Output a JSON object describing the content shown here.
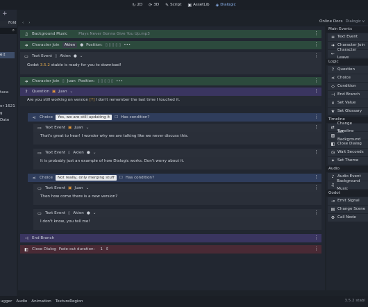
{
  "topbar": {
    "modes": [
      {
        "icon": "↻",
        "label": "2D"
      },
      {
        "icon": "⟳",
        "label": "3D"
      },
      {
        "icon": "✎",
        "label": "Script"
      },
      {
        "icon": "▣",
        "label": "AssetLib"
      },
      {
        "icon": "◈",
        "label": "Dialogic"
      }
    ]
  },
  "left": {
    "filter_label": "Fold",
    "items": [
      "e.t",
      "taca",
      "er 1621",
      "g",
      "Date"
    ]
  },
  "top_right": {
    "docs": "Online Docs",
    "dialogic": "Dialogic v"
  },
  "timeline": {
    "bg_music": {
      "label": "Background Music",
      "file": "Plays Never Gonna Give You Up.mp3"
    },
    "join1": {
      "label": "Character Join",
      "character": "Akien",
      "pos_label": "Position:"
    },
    "text1": {
      "label": "Text Event",
      "character": "Akien",
      "body_a": "Godot ",
      "body_ver": "3.5.2",
      "body_b": " stable is ready for you to download!"
    },
    "join2": {
      "label": "Character Join",
      "character": "Juan",
      "pos_label": "Position:"
    },
    "question": {
      "label": "Question",
      "character": "Juan",
      "body": "Are you still working on version ",
      "body_b": "[?]",
      "body_c": " I don't remember the last time I touched it."
    },
    "choice1": {
      "label": "Choice",
      "value": "Yes, we are still updating it",
      "cond": "Has condition?"
    },
    "text2": {
      "label": "Text Event",
      "character": "Juan",
      "body": "That's great to hear! I wonder why we are talking like we never discuss this."
    },
    "text3": {
      "label": "Text Event",
      "character": "Akien",
      "body": "It is probably just an example of how Dialogic works. Don't worry about it."
    },
    "choice2": {
      "label": "Choice",
      "value": "Not really, only merging stuff",
      "cond": "Has condition?"
    },
    "text4": {
      "label": "Text Event",
      "character": "Juan",
      "body": "Then how come there is a new version?"
    },
    "text5": {
      "label": "Text Event",
      "character": "Akien",
      "body": "I don't know, you tell me!"
    },
    "end_branch": {
      "label": "End Branch"
    },
    "close_dialog": {
      "label": "Close Dialog",
      "fade": "Fade-out duration:",
      "fade_value": "1"
    }
  },
  "right": {
    "sections": [
      {
        "title": "Main Events",
        "items": [
          {
            "icon": "≡",
            "label": "Text Event"
          },
          {
            "icon": "➜",
            "label": "Character Join"
          },
          {
            "icon": "←",
            "label": "Character Leave"
          }
        ]
      },
      {
        "title": "Logic",
        "items": [
          {
            "icon": "?",
            "label": "Question"
          },
          {
            "icon": "⋖",
            "label": "Choice"
          },
          {
            "icon": "◇",
            "label": "Condition"
          },
          {
            "icon": "⊣",
            "label": "End Branch"
          },
          {
            "icon": "x",
            "label": "Set Value"
          },
          {
            "icon": "★",
            "label": "Set Glossary"
          }
        ]
      },
      {
        "title": "Timeline",
        "items": [
          {
            "icon": "⇄",
            "label": "Change Timeline"
          },
          {
            "icon": "▨",
            "label": "Set Background"
          },
          {
            "icon": "◧",
            "label": "Close Dialog"
          },
          {
            "icon": "◷",
            "label": "Wait Seconds"
          },
          {
            "icon": "✦",
            "label": "Set Theme"
          }
        ]
      },
      {
        "title": "Audio",
        "items": [
          {
            "icon": "♪",
            "label": "Audio Event"
          },
          {
            "icon": "♫",
            "label": "Background Music"
          }
        ]
      },
      {
        "title": "Godot",
        "items": [
          {
            "icon": "⇥",
            "label": "Emit Signal"
          },
          {
            "icon": "▤",
            "label": "Change Scene"
          },
          {
            "icon": "⚙",
            "label": "Call Node"
          }
        ]
      }
    ]
  },
  "bottom": {
    "tabs": [
      "ugger",
      "Audio",
      "Animation",
      "TextureRegion"
    ],
    "version": "3.5.2 stabl"
  }
}
